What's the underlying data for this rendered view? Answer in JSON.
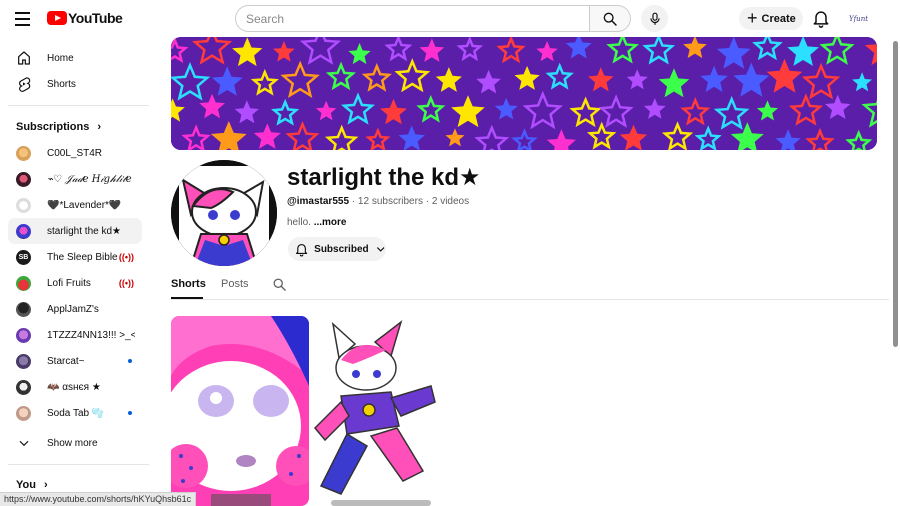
{
  "topbar": {
    "logo_text": "YouTube",
    "search_placeholder": "Search",
    "create_label": "Create",
    "avatar_text": "Yfunt"
  },
  "sidebar": {
    "main_items": [
      {
        "label": "Home",
        "icon": "home-icon"
      },
      {
        "label": "Shorts",
        "icon": "shorts-icon"
      }
    ],
    "subscriptions_label": "Subscriptions",
    "subscriptions": [
      {
        "label": "C00L_ST4R",
        "indicator": ""
      },
      {
        "label": "⌁♡ 𝒥𝒶𝒹𝑒 𝐻𝒾𝑔𝒽𝓁𝒾𝓉𝑒",
        "indicator": ""
      },
      {
        "label": "🖤*Lavender*🖤",
        "indicator": ""
      },
      {
        "label": "starlight the kd★",
        "indicator": "",
        "active": true
      },
      {
        "label": "The Sleep Bible",
        "indicator": "live"
      },
      {
        "label": "Lofi Fruits",
        "indicator": "live"
      },
      {
        "label": "ApplJamZ's",
        "indicator": ""
      },
      {
        "label": "1TZZZ4NN13!!! >_<...",
        "indicator": ""
      },
      {
        "label": "Starcat~",
        "indicator": "dot"
      },
      {
        "label": "🦇 αѕнєя ★",
        "indicator": ""
      },
      {
        "label": "Soda Tab 🫧",
        "indicator": "dot"
      }
    ],
    "show_more_label": "Show more",
    "you_label": "You",
    "live_glyph": "((•))"
  },
  "channel": {
    "name": "starlight the kd★",
    "handle": "@imastar555",
    "subscribers": "12 subscribers",
    "videos": "2 videos",
    "separator": "·",
    "description": "hello.",
    "more_label": "...more",
    "subscribed_label": "Subscribed"
  },
  "tabs": [
    {
      "label": "Shorts",
      "active": true
    },
    {
      "label": "Posts",
      "active": false
    }
  ],
  "status_url": "https://www.youtube.com/shorts/hKYuQhsb61c",
  "colors": {
    "brand_red": "#ff0000",
    "banner_purple": "#5b1ea8",
    "link_blue": "#065fd4"
  }
}
